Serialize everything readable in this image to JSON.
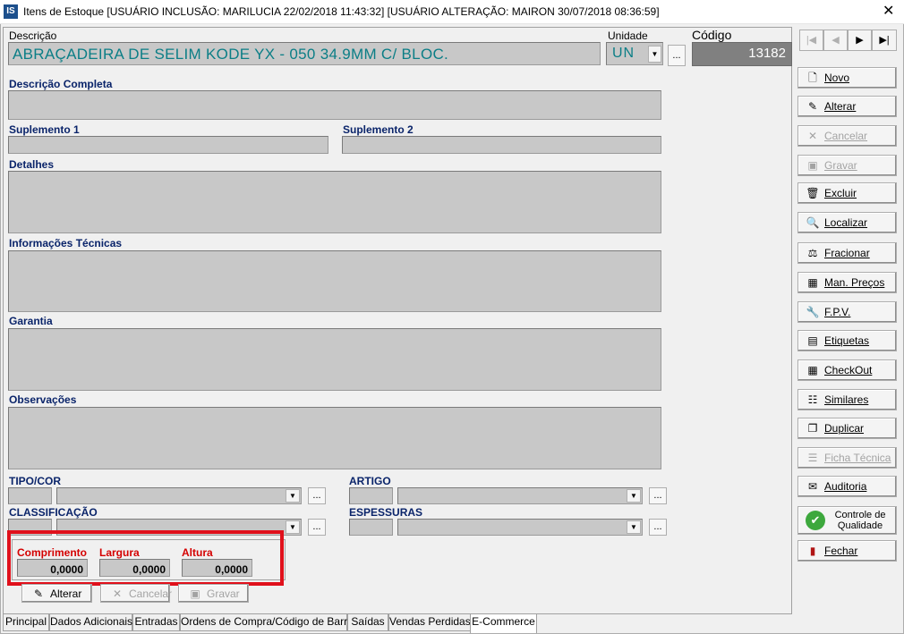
{
  "window": {
    "title": "Itens de Estoque  [USUÁRIO INCLUSÃO: MARILUCIA 22/02/2018 11:43:32]  [USUÁRIO ALTERAÇÃO: MAIRON 30/07/2018 08:36:59]",
    "logo": "IS",
    "close": "✕"
  },
  "header": {
    "descricao_label": "Descrição",
    "descricao_value": "ABRAÇADEIRA DE SELIM KODE YX - 050 34.9MM C/ BLOC.",
    "unidade_label": "Unidade",
    "unidade_value": "UN",
    "codigo_label": "Código",
    "codigo_value": "13182",
    "dots": "..."
  },
  "nav": {
    "first": "|◀",
    "prev": "◀",
    "next": "▶",
    "last": "▶|"
  },
  "fields": {
    "descricao_completa": "Descrição Completa",
    "suplemento1": "Suplemento 1",
    "suplemento2": "Suplemento 2",
    "detalhes": "Detalhes",
    "info_tecnicas": "Informações Técnicas",
    "garantia": "Garantia",
    "observacoes": "Observações",
    "tipo_cor": "TIPO/COR",
    "artigo": "ARTIGO",
    "classificacao": "CLASSIFICAÇÃO",
    "espessuras": "ESPESSURAS"
  },
  "dimensions": {
    "comprimento_label": "Comprimento",
    "comprimento_value": "0,0000",
    "largura_label": "Largura",
    "largura_value": "0,0000",
    "altura_label": "Altura",
    "altura_value": "0,0000"
  },
  "bottom_buttons": {
    "alterar": "Alterar",
    "cancelar": "Cancelar",
    "gravar": "Gravar"
  },
  "tabs": [
    "Principal",
    "Dados Adicionais",
    "Entradas",
    "Ordens de Compra/Código de Barras",
    "Saídas",
    "Vendas Perdidas",
    "E-Commerce"
  ],
  "side_buttons": [
    {
      "label": "Novo",
      "icon": "new-document-icon",
      "enabled": true
    },
    {
      "label": "Alterar",
      "icon": "edit-icon",
      "enabled": true
    },
    {
      "label": "Cancelar",
      "icon": "cancel-icon",
      "enabled": false
    },
    {
      "label": "Gravar",
      "icon": "save-icon",
      "enabled": false
    },
    {
      "label": "Excluir",
      "icon": "trash-icon",
      "enabled": true
    },
    {
      "label": "Localizar",
      "icon": "search-icon",
      "enabled": true
    },
    {
      "label": "Fracionar",
      "icon": "split-icon",
      "enabled": true
    },
    {
      "label": "Man. Preços",
      "icon": "calculator-icon",
      "enabled": true
    },
    {
      "label": "F.P.V.",
      "icon": "tools-icon",
      "enabled": true
    },
    {
      "label": "Etiquetas",
      "icon": "labels-icon",
      "enabled": true
    },
    {
      "label": "CheckOut",
      "icon": "grid-icon",
      "enabled": true
    },
    {
      "label": "Similares",
      "icon": "tree-icon",
      "enabled": true
    },
    {
      "label": "Duplicar",
      "icon": "duplicate-icon",
      "enabled": true
    },
    {
      "label": "Ficha Técnica",
      "icon": "sheet-icon",
      "enabled": false
    },
    {
      "label": "Auditoria",
      "icon": "certificate-icon",
      "enabled": true
    },
    {
      "label": "Controle de Qualidade",
      "icon": "check-circle-icon",
      "enabled": true
    },
    {
      "label": "Fechar",
      "icon": "exit-door-icon",
      "enabled": true
    }
  ],
  "colors": {
    "field_bg": "#c8c8c8",
    "value_text": "#0b7e86",
    "label_blue": "#0a246a",
    "label_red": "#d40000",
    "highlight": "#e0101b"
  }
}
